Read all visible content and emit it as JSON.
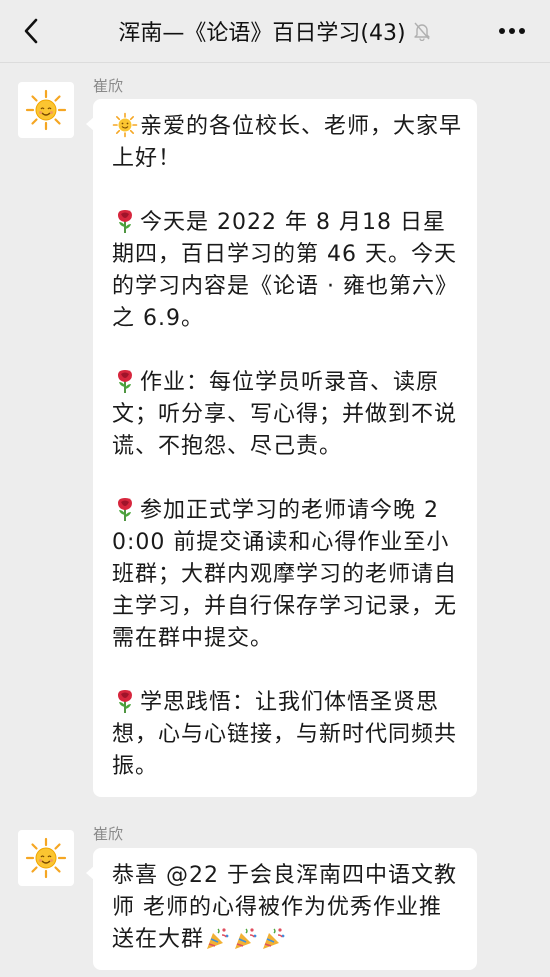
{
  "header": {
    "back_icon": "chevron-left-icon",
    "title": "浑南—《论语》百日学习(43)",
    "mute_icon": "bell-muted-icon",
    "more_icon": "more-dots-icon"
  },
  "messages": [
    {
      "sender": "崔欣",
      "avatar_icon": "sun-avatar-icon",
      "paragraphs": [
        {
          "icon": "smiling-sun-emoji",
          "text": "亲爱的各位校长、老师，大家早上好！"
        },
        {
          "icon": "rose-emoji",
          "text": "今天是 2022 年 8 月18 日星期四，百日学习的第 46 天。今天的学习内容是《论语 · 雍也第六》 之 6.9。"
        },
        {
          "icon": "rose-emoji",
          "text": "作业：每位学员听录音、读原文；听分享、写心得；并做到不说谎、不抱怨、尽己责。"
        },
        {
          "icon": "rose-emoji",
          "text": "参加正式学习的老师请今晚 20:00 前提交诵读和心得作业至小班群；大群内观摩学习的老师请自主学习，并自行保存学习记录，无需在群中提交。"
        },
        {
          "icon": "rose-emoji",
          "text": "学思践悟：让我们体悟圣贤思想，心与心链接，与新时代同频共振。"
        }
      ]
    },
    {
      "sender": "崔欣",
      "avatar_icon": "sun-avatar-icon",
      "text": "恭喜 @22 于会良浑南四中语文教师 老师的心得被作为优秀作业推送在大群",
      "trailing_icons": [
        "party-popper-emoji",
        "party-popper-emoji",
        "party-popper-emoji"
      ]
    }
  ]
}
